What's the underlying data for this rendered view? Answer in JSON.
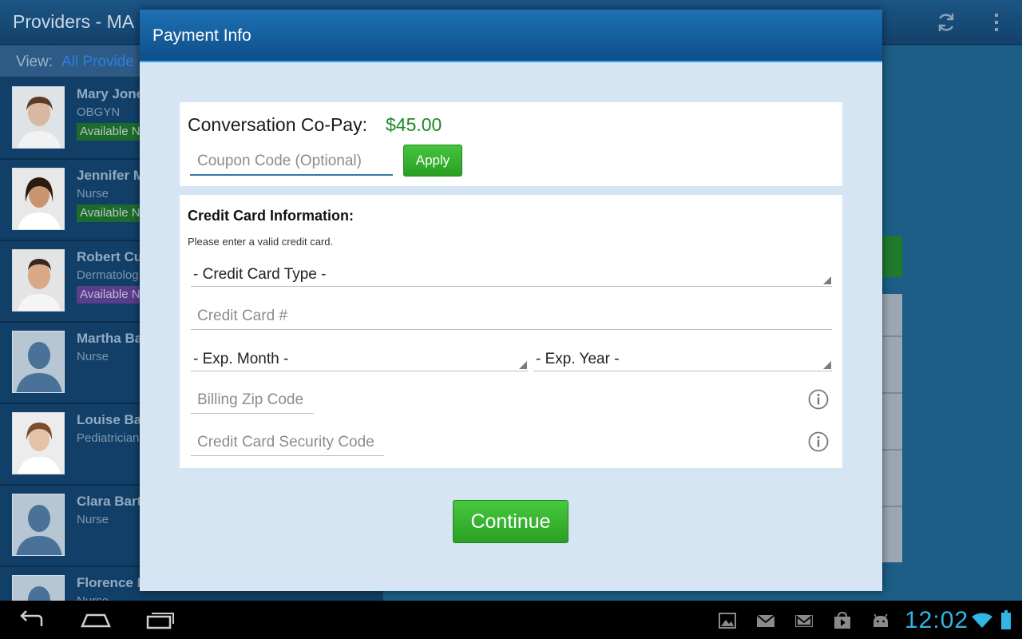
{
  "app": {
    "title": "Providers - MA",
    "view_label": "View:",
    "view_value": "All Provide"
  },
  "providers": [
    {
      "name": "Mary Jone",
      "role": "OBGYN",
      "status": "Available N"
    },
    {
      "name": "Jennifer M",
      "role": "Nurse",
      "status": "Available N"
    },
    {
      "name": "Robert Cu",
      "role": "Dermatolog",
      "status": "Available N"
    },
    {
      "name": "Martha Ba",
      "role": "Nurse",
      "status": ""
    },
    {
      "name": "Louise Ba",
      "role": "Pediatrician",
      "status": ""
    },
    {
      "name": "Clara Bart",
      "role": "Nurse",
      "status": ""
    },
    {
      "name": "Florence E",
      "role": "Nurse",
      "status": ""
    }
  ],
  "dialog": {
    "title": "Payment Info",
    "copay_label": "Conversation Co-Pay:",
    "copay_amount": "$45.00",
    "coupon_placeholder": "Coupon Code (Optional)",
    "apply_label": "Apply",
    "cc_heading": "Credit Card Information:",
    "cc_note": "Please enter a valid credit card.",
    "cc_type": "- Credit Card Type -",
    "cc_number_placeholder": "Credit Card #",
    "exp_month": "- Exp. Month -",
    "exp_year": "- Exp. Year -",
    "zip_placeholder": "Billing Zip Code",
    "security_placeholder": "Credit Card Security Code",
    "continue_label": "Continue"
  },
  "system_bar": {
    "clock": "12:02"
  },
  "colors": {
    "accent_green": "#1b8a24",
    "button_green": "#2aa023",
    "header_blue": "#0f4d88",
    "clock_blue": "#33b5e5"
  }
}
